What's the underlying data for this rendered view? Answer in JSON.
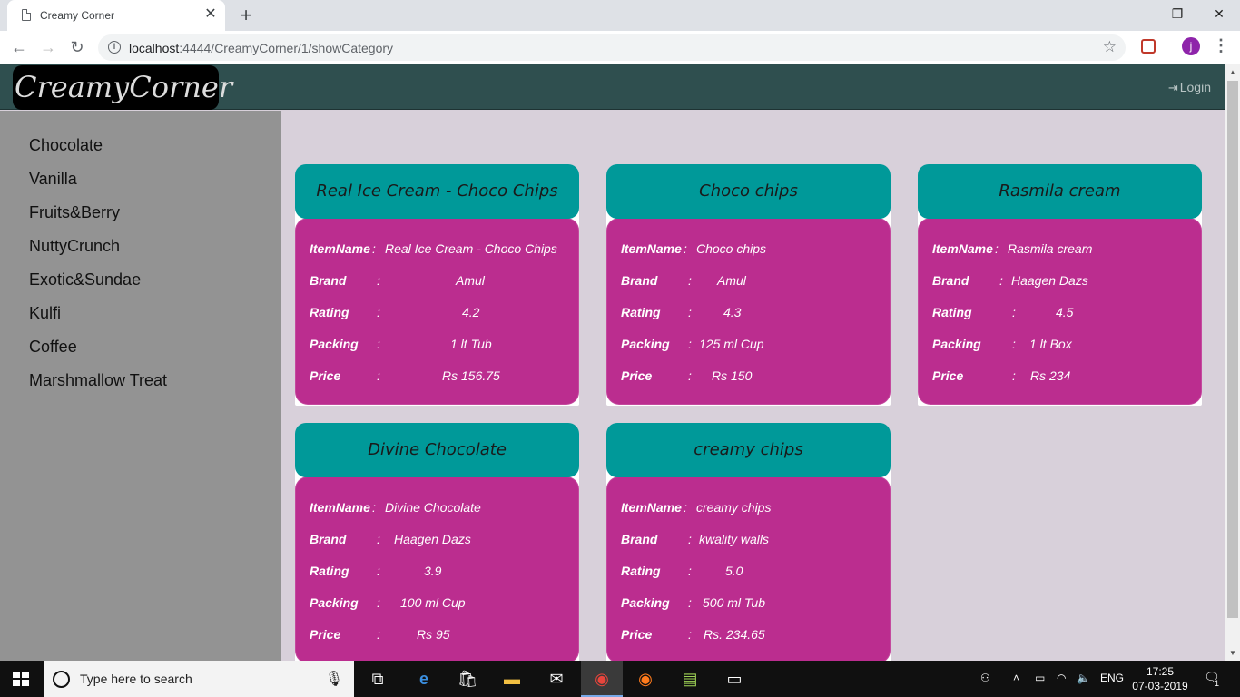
{
  "browser": {
    "tab_title": "Creamy Corner",
    "tab_close": "✕",
    "new_tab": "+",
    "url_host": "localhost",
    "url_rest": ":4444/CreamyCorner/1/showCategory",
    "avatar_letter": "j",
    "window_minimize": "—",
    "window_restore": "❐",
    "window_close": "✕"
  },
  "header": {
    "logo": "CreamyCorner",
    "login": "Login"
  },
  "sidebar": {
    "items": [
      {
        "label": "Chocolate"
      },
      {
        "label": "Vanilla"
      },
      {
        "label": "Fruits&Berry"
      },
      {
        "label": "NuttyCrunch"
      },
      {
        "label": "Exotic&Sundae"
      },
      {
        "label": "Kulfi"
      },
      {
        "label": "Coffee"
      },
      {
        "label": "Marshmallow Treat"
      }
    ]
  },
  "field_labels": {
    "item_name": "ItemName",
    "brand": "Brand",
    "rating": "Rating",
    "packing": "Packing",
    "price": "Price",
    "colon": ":"
  },
  "products": [
    {
      "title": "Real Ice Cream - Choco Chips",
      "item_name": "Real Ice Cream - Choco Chips",
      "brand": "Amul",
      "rating": "4.2",
      "packing": "1 lt Tub",
      "price": "Rs 156.75"
    },
    {
      "title": "Choco chips",
      "item_name": "Choco chips",
      "brand": "Amul",
      "rating": "4.3",
      "packing": "125 ml Cup",
      "price": "Rs 150"
    },
    {
      "title": "Rasmila cream",
      "item_name": "Rasmila cream",
      "brand": "Haagen Dazs",
      "rating": "4.5",
      "packing": "1 lt Box",
      "price": "Rs 234"
    },
    {
      "title": "Divine Chocolate",
      "item_name": "Divine Chocolate",
      "brand": "Haagen Dazs",
      "rating": "3.9",
      "packing": "100 ml Cup",
      "price": "Rs 95"
    },
    {
      "title": "creamy chips",
      "item_name": "creamy chips",
      "brand": "kwality walls",
      "rating": "5.0",
      "packing": "500 ml Tub",
      "price": "Rs. 234.65"
    }
  ],
  "taskbar": {
    "search_placeholder": "Type here to search",
    "language": "ENG",
    "time": "17:25",
    "date": "07-03-2019",
    "notification_count": "1"
  },
  "colors": {
    "header_bg": "#2f4f4f",
    "card_head": "#009999",
    "card_body": "#bb2d8f",
    "sidebar_bg": "#939393",
    "page_bg": "#d8d0da"
  }
}
